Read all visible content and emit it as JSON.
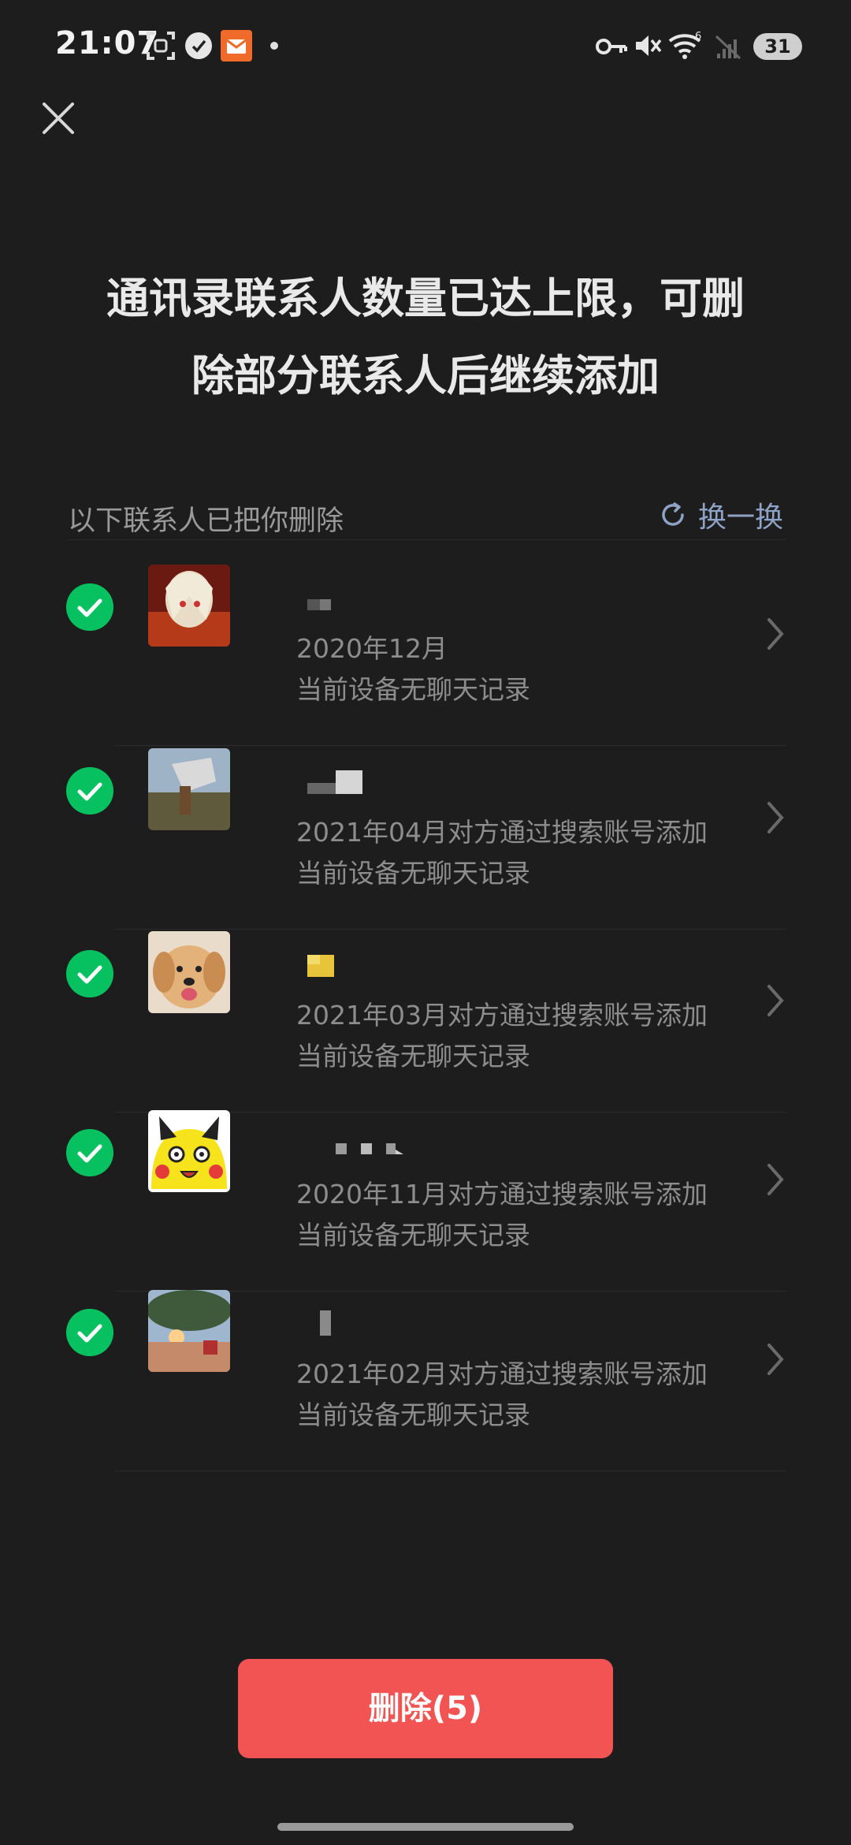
{
  "status_bar": {
    "time": "21:07",
    "battery": "31"
  },
  "header": {
    "close_icon": "close-icon",
    "title_line1": "通讯录联系人数量已达上限，可删",
    "title_line2": "除部分联系人后继续添加"
  },
  "section": {
    "label": "以下联系人已把你删除",
    "refresh_label": "换一换",
    "refresh_icon": "refresh-icon"
  },
  "contacts": [
    {
      "line1": "2020年12月",
      "line2": "当前设备无聊天记录",
      "checked": true,
      "avatar_icon": "anime-avatar-icon"
    },
    {
      "line1": "2021年04月对方通过搜索账号添加",
      "line2": "当前设备无聊天记录",
      "checked": true,
      "avatar_icon": "outdoor-photo-avatar-icon"
    },
    {
      "line1": "2021年03月对方通过搜索账号添加",
      "line2": "当前设备无聊天记录",
      "checked": true,
      "avatar_icon": "dog-avatar-icon"
    },
    {
      "line1": "2020年11月对方通过搜索账号添加",
      "line2": "当前设备无聊天记录",
      "checked": true,
      "avatar_icon": "pikachu-avatar-icon"
    },
    {
      "line1": "2021年02月对方通过搜索账号添加",
      "line2": "当前设备无聊天记录",
      "checked": true,
      "avatar_icon": "sunset-avatar-icon"
    }
  ],
  "footer": {
    "delete_label": "删除(5)"
  },
  "colors": {
    "background": "#1d1d1d",
    "check_green": "#07c160",
    "delete_red": "#f25453",
    "link_blue": "#8ea2c6"
  }
}
